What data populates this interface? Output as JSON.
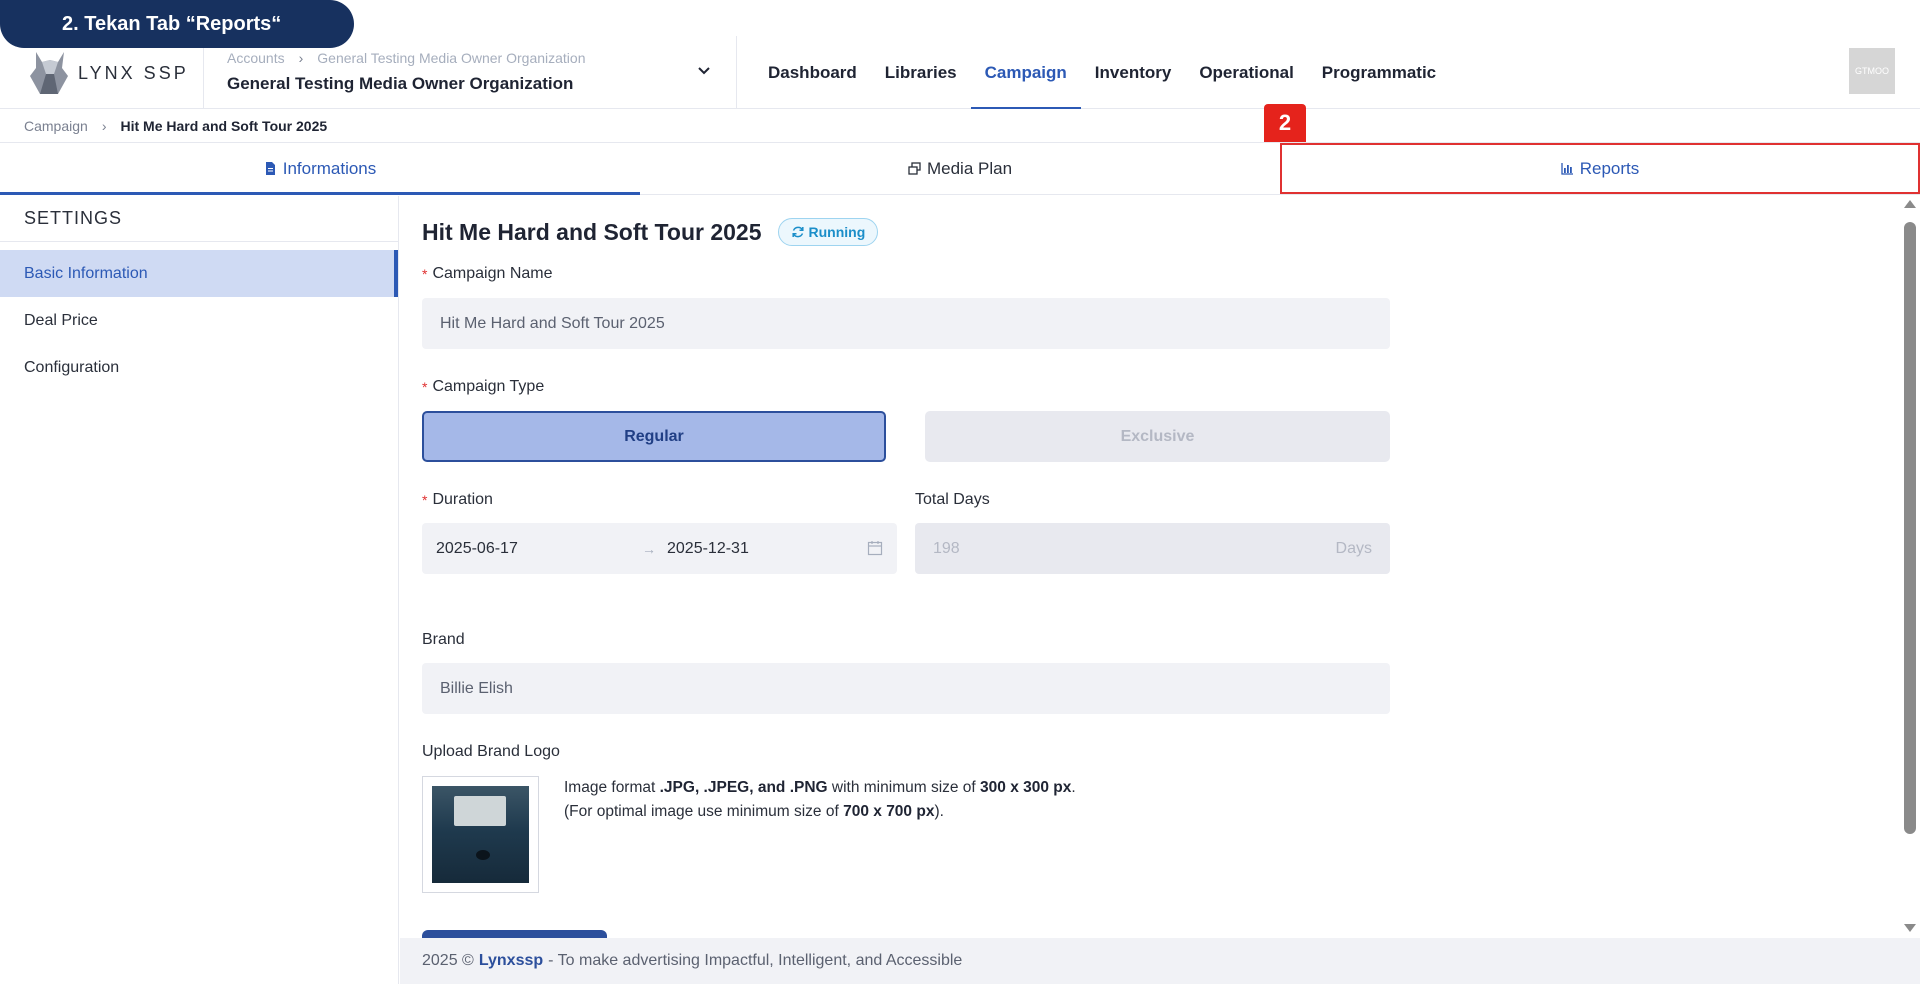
{
  "callout": {
    "text": "2. Tekan Tab “Reports“"
  },
  "step_badge": "2",
  "header": {
    "logo_text": "LYNX SSP",
    "org_breadcrumb": {
      "parent": "Accounts",
      "child": "General Testing Media Owner Organization"
    },
    "org_title": "General Testing Media Owner Organization",
    "nav": [
      "Dashboard",
      "Libraries",
      "Campaign",
      "Inventory",
      "Operational",
      "Programmatic"
    ],
    "nav_active": "Campaign",
    "avatar_text": "GTMOO"
  },
  "breadcrumb": {
    "parent": "Campaign",
    "current": "Hit Me Hard and Soft Tour 2025"
  },
  "tabs": {
    "informations": "Informations",
    "media_plan": "Media Plan",
    "reports": "Reports"
  },
  "sidebar": {
    "title": "SETTINGS",
    "items": [
      "Basic Information",
      "Deal Price",
      "Configuration"
    ]
  },
  "main": {
    "title": "Hit Me Hard and Soft Tour 2025",
    "status": "Running",
    "campaign_name_label": "Campaign Name",
    "campaign_name_value": "Hit Me Hard and Soft Tour 2025",
    "campaign_type_label": "Campaign Type",
    "campaign_type_options": [
      "Regular",
      "Exclusive"
    ],
    "campaign_type_selected": "Regular",
    "duration_label": "Duration",
    "duration_start": "2025-06-17",
    "duration_end": "2025-12-31",
    "total_days_label": "Total Days",
    "total_days_value": "198",
    "total_days_unit": "Days",
    "brand_label": "Brand",
    "brand_value": "Billie Elish",
    "upload_label": "Upload Brand Logo",
    "upload_hint": {
      "line1_a": "Image format ",
      "line1_b": ".JPG, .JPEG, and .PNG",
      "line1_c": " with minimum size of ",
      "line1_d": "300 x 300 px",
      "line1_e": ".",
      "line2_a": "(For optimal image use minimum size of ",
      "line2_b": "700 x 700 px",
      "line2_c": ")."
    }
  },
  "footer": {
    "prefix": "2025 ©",
    "brand": "Lynxssp",
    "suffix": "- To make advertising Impactful, Intelligent, and Accessible"
  },
  "colors": {
    "accent": "#2c59b5",
    "callout": "#17315f",
    "highlight": "#e03131",
    "status": "#1b8ec9"
  }
}
